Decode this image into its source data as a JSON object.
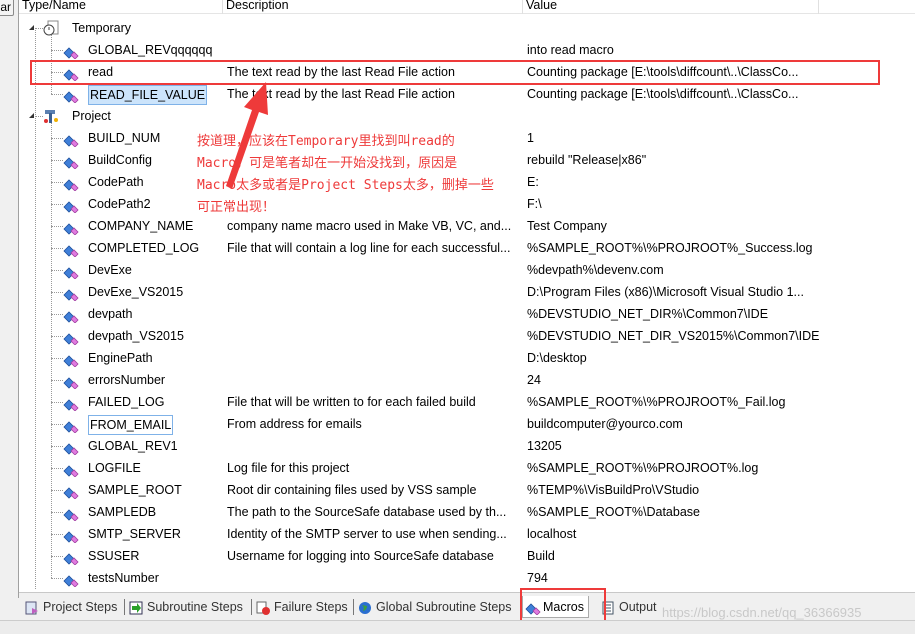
{
  "left_button_label": "ar",
  "columns": {
    "name": "Type/Name",
    "description": "Description",
    "value": "Value"
  },
  "groups": [
    {
      "name": "Temporary",
      "icon": "stopwatch-document-icon",
      "macros": [
        {
          "name": "GLOBAL_REVqqqqqq",
          "description": "",
          "value": "into read macro"
        },
        {
          "name": "read",
          "description": "The text read by the last Read File action",
          "value": "Counting package [E:\\tools\\diffcount\\..\\ClassCo..."
        },
        {
          "name": "READ_FILE_VALUE",
          "description": "The text read by the last Read File action",
          "value": "Counting package [E:\\tools\\diffcount\\..\\ClassCo...",
          "selected": true
        }
      ]
    },
    {
      "name": "Project",
      "icon": "project-hammer-icon",
      "macros": [
        {
          "name": "BUILD_NUM",
          "description": "",
          "value": "1"
        },
        {
          "name": "BuildConfig",
          "description": "",
          "value": "rebuild \"Release|x86\""
        },
        {
          "name": "CodePath",
          "description": "",
          "value": "E:"
        },
        {
          "name": "CodePath2",
          "description": "",
          "value": "F:\\"
        },
        {
          "name": "COMPANY_NAME",
          "description": "company name macro used in Make VB, VC, and...",
          "value": "Test Company"
        },
        {
          "name": "COMPLETED_LOG",
          "description": "File that will contain a log line for each successful...",
          "value": "%SAMPLE_ROOT%\\%PROJROOT%_Success.log"
        },
        {
          "name": "DevExe",
          "description": "",
          "value": "%devpath%\\devenv.com"
        },
        {
          "name": "DevExe_VS2015",
          "description": "",
          "value": "D:\\Program Files (x86)\\Microsoft Visual Studio 1..."
        },
        {
          "name": "devpath",
          "description": "",
          "value": "%DEVSTUDIO_NET_DIR%\\Common7\\IDE"
        },
        {
          "name": "devpath_VS2015",
          "description": "",
          "value": "%DEVSTUDIO_NET_DIR_VS2015%\\Common7\\IDE"
        },
        {
          "name": "EnginePath",
          "description": "",
          "value": "D:\\desktop"
        },
        {
          "name": "errorsNumber",
          "description": "",
          "value": "24"
        },
        {
          "name": "FAILED_LOG",
          "description": "File that will be written to for each failed build",
          "value": "%SAMPLE_ROOT%\\%PROJROOT%_Fail.log"
        },
        {
          "name": "FROM_EMAIL",
          "description": "From address for emails",
          "value": "buildcomputer@yourco.com",
          "focused": true
        },
        {
          "name": "GLOBAL_REV1",
          "description": "",
          "value": "13205"
        },
        {
          "name": "LOGFILE",
          "description": "Log file for this project",
          "value": "%SAMPLE_ROOT%\\%PROJROOT%.log"
        },
        {
          "name": "SAMPLE_ROOT",
          "description": "Root dir containing files used by VSS sample",
          "value": "%TEMP%\\VisBuildPro\\VStudio"
        },
        {
          "name": "SAMPLEDB",
          "description": "The path to the SourceSafe database used by th...",
          "value": "%SAMPLE_ROOT%\\Database"
        },
        {
          "name": "SMTP_SERVER",
          "description": "Identity of the SMTP server to use when sending...",
          "value": "localhost"
        },
        {
          "name": "SSUSER",
          "description": "Username for logging into SourceSafe database",
          "value": "Build"
        },
        {
          "name": "testsNumber",
          "description": "",
          "value": "794"
        }
      ]
    }
  ],
  "tabs": [
    {
      "label": "Project Steps",
      "icon": "project-steps-icon"
    },
    {
      "label": "Subroutine Steps",
      "icon": "subroutine-steps-icon"
    },
    {
      "label": "Failure Steps",
      "icon": "failure-steps-icon"
    },
    {
      "label": "Global Subroutine Steps",
      "icon": "globe-icon"
    },
    {
      "label": "Macros",
      "icon": "macro-icon",
      "active": true
    },
    {
      "label": "Output",
      "icon": "output-document-icon"
    }
  ],
  "annotation": {
    "color": "#ee3a3a",
    "lines": [
      "按道理，应该在Temporary里找到叫read的",
      "Macro，可是笔者却在一开始没找到，原因是",
      "Macro太多或者是Project Steps太多，删掉一些",
      "可正常出现！"
    ]
  },
  "watermark": "https://blog.csdn.net/qq_36366935"
}
